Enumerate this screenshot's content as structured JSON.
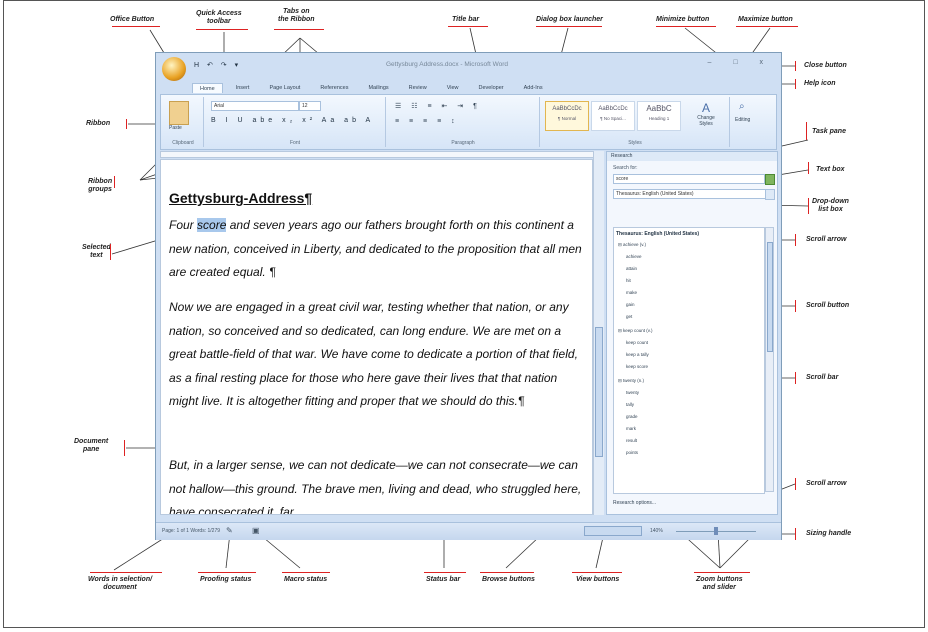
{
  "callouts": {
    "office_button": "Office Button",
    "quick_access_toolbar": "Quick Access\ntoolbar",
    "tabs_on_ribbon": "Tabs on\nthe Ribbon",
    "title_bar": "Title bar",
    "dialog_box_launcher": "Dialog box launcher",
    "minimize_button": "Minimize button",
    "maximize_button": "Maximize button",
    "close_button": "Close button",
    "help_icon": "Help icon",
    "ribbon": "Ribbon",
    "task_pane": "Task pane",
    "ribbon_groups": "Ribbon\ngroups",
    "text_box": "Text box",
    "drop_down_list_box": "Drop-down\nlist box",
    "selected_text": "Selected\ntext",
    "scroll_arrow_top": "Scroll arrow",
    "scroll_button": "Scroll button",
    "scroll_bar": "Scroll bar",
    "document_pane": "Document\npane",
    "scroll_arrow_bottom": "Scroll arrow",
    "sizing_handle": "Sizing handle",
    "words_in_selection": "Words in selection/\ndocument",
    "proofing_status": "Proofing status",
    "macro_status": "Macro status",
    "status_bar": "Status bar",
    "browse_buttons": "Browse buttons",
    "view_buttons": "View buttons",
    "zoom_buttons_slider": "Zoom buttons\nand slider"
  },
  "window": {
    "title": "Gettysburg Address.docx - Microsoft Word",
    "qat": "H ↶ ↷ ▾",
    "controls": "– □ x",
    "tabs": [
      "Home",
      "Insert",
      "Page Layout",
      "References",
      "Mailings",
      "Review",
      "View",
      "Developer",
      "Add-Ins"
    ],
    "ribbon": {
      "paste": "Paste",
      "font_name": "Arial",
      "font_size": "12",
      "format_row": "B I U abe x₂ x² Aa ab A",
      "groups": [
        "Clipboard",
        "Font",
        "Paragraph",
        "Styles",
        "Editing"
      ],
      "styles": [
        {
          "preview": "AaBbCcDc",
          "name": "¶ Normal"
        },
        {
          "preview": "AaBbCcDc",
          "name": "¶ No Spaci..."
        },
        {
          "preview": "AaBbC",
          "name": "Heading 1"
        }
      ],
      "change_styles": "Change Styles",
      "editing": "Editing"
    }
  },
  "document": {
    "title": "Gettysburg-Address¶",
    "para1_a": "Four",
    "para1_sel": "score",
    "para1_b": "and seven years ago our fathers brought forth on this continent a new nation, conceived in Liberty, and dedicated to the proposition that all men are created equal. ¶",
    "para2": "Now we are engaged in a great civil war, testing whether that nation, or any nation, so conceived and so dedicated, can long endure. We are met on a great battle-field of that war. We have come to dedicate a portion of that field, as a final resting place for those who here gave their lives that that nation might live. It is altogether fitting and proper that we should do this.¶",
    "para3": "But, in a larger sense, we can not dedicate—we can not consecrate—we can not hallow—this ground. The brave men, living and dead, who struggled here, have consecrated it, far"
  },
  "task_pane": {
    "header": "Research",
    "search_label": "Search for:",
    "search_value": "score",
    "dropdown_value": "Thesaurus: English (United States)",
    "results_header": "Thesaurus: English (United States)",
    "items": [
      "⊟ achieve (v.)",
      "achieve",
      "attain",
      "hit",
      "make",
      "gain",
      "get",
      "⊟ keep count (v.)",
      "keep count",
      "keep a tally",
      "keep score",
      "⊟ twenty (n.)",
      "twenty",
      "tally",
      "grade",
      "mark",
      "result",
      "points"
    ],
    "options": "Research options..."
  },
  "status_bar": {
    "words": "Page: 1 of 1   Words: 1/279",
    "zoom": "140%"
  }
}
